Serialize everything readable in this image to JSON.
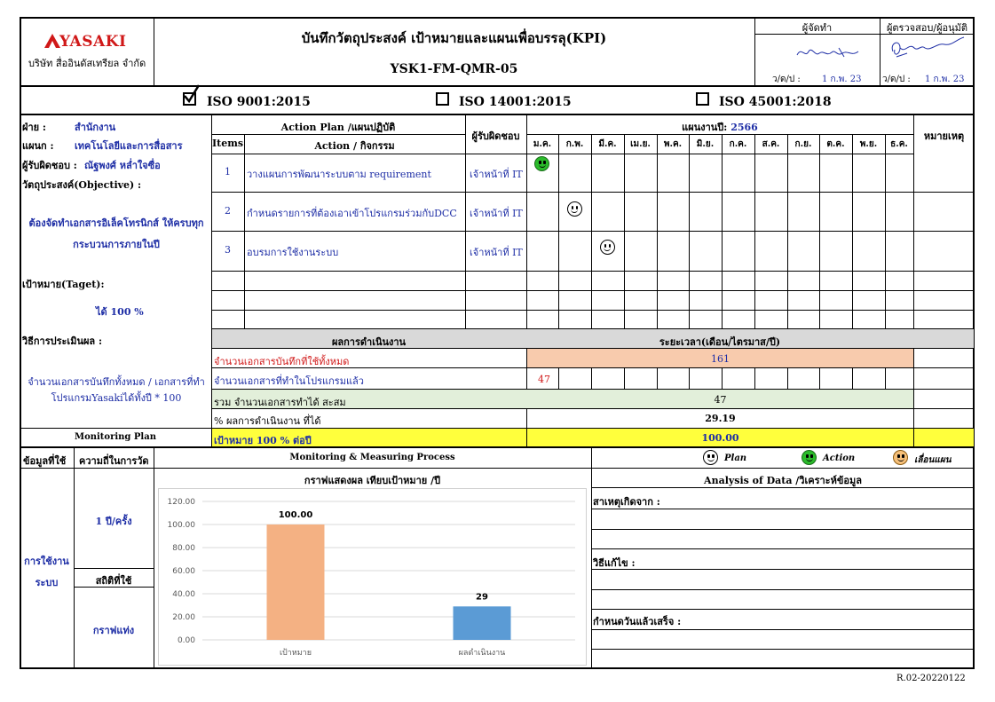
{
  "company": {
    "logo_text": "YASAKI",
    "name_th": "บริษัท สื่ออินดัสเทรียล จำกัด"
  },
  "header": {
    "title": "บันทึกวัตถุประสงค์ เป้าหมายและแผนเพื่อบรรลุ(KPI)",
    "form_code": "YSK1-FM-QMR-05",
    "prepared_by_label": "ผู้จัดทำ",
    "reviewed_by_label": "ผู้ตรวจสอบ/ผู้อนุมัติ",
    "date_label": "ว/ด/ป :",
    "prepared_date": "1 ก.พ. 23",
    "reviewed_date": "1 ก.พ. 23"
  },
  "iso": {
    "items": [
      {
        "label": "ISO 9001:2015",
        "checked": true
      },
      {
        "label": "ISO 14001:2015",
        "checked": false
      },
      {
        "label": "ISO 45001:2018",
        "checked": false
      }
    ]
  },
  "left": {
    "dept_label": "ฝ่าย :",
    "dept_value": "สำนักงาน",
    "section_label": "แผนก :",
    "section_value": "เทคโนโลยีและการสื่อสาร",
    "owner_label": "ผู้รับผิดชอบ :",
    "owner_value": "ณัฐพงศ์ หล่ำใจซื่อ",
    "objective_label": "วัตถุประสงค์(Objective) :",
    "objective_line1": "ต้องจัดทำเอกสารอิเล็คโทรนิกส์ ให้ครบทุก",
    "objective_line2": "กระบวนการภายในปี",
    "target_label": "เป้าหมาย(Taget):",
    "target_value": "ได้ 100 %",
    "eval_label": "วิธีการประเมินผล :",
    "eval_line1": "จำนวนเอกสารบันทึกทั้งหมด / เอกสารที่ทำ",
    "eval_line2": "โปรแกรมYasakiได้ทั้งปี * 100"
  },
  "plan": {
    "action_plan_label": "Action Plan /แผนปฏิบัติ",
    "items_label": "Items",
    "action_label": "Action / กิจกรรม",
    "responsible_label": "ผู้รับผิดชอบ",
    "year_label": "แผนงานปี:",
    "year_value": "2566",
    "remark_label": "หมายเหตุ",
    "months": [
      "ม.ค.",
      "ก.พ.",
      "มี.ค.",
      "เม.ย.",
      "พ.ค.",
      "มิ.ย.",
      "ก.ค.",
      "ส.ค.",
      "ก.ย.",
      "ต.ค.",
      "พ.ย.",
      "ธ.ค."
    ],
    "rows": [
      {
        "no": "1",
        "action": "วางแผนการพัฒนาระบบตาม requirement",
        "owner": "เจ้าหน้าที่ IT",
        "month_index": 0,
        "status": "action"
      },
      {
        "no": "2",
        "action": "กำหนดรายการที่ต้องเอาเข้าโปรแกรมร่วมกับDCC",
        "owner": "เจ้าหน้าที่ IT",
        "month_index": 1,
        "status": "plan"
      },
      {
        "no": "3",
        "action": "อบรมการใช้งานระบบ",
        "owner": "เจ้าหน้าที่ IT",
        "month_index": 2,
        "status": "plan"
      }
    ]
  },
  "results": {
    "result_label": "ผลการดำเนินงาน",
    "period_label": "ระยะเวลา(เดือน/ไตรมาส/ปี)",
    "total_docs_label": "จำนวนเอกสารบันทึกที่ใช้ทั้งหมด",
    "total_docs_value": "161",
    "done_docs_label": "จำนวนเอกสารที่ทำในโปรแกรมแล้ว",
    "done_docs_jan": "47",
    "cumulative_label": "รวม จำนวนเอกสารทำได้ สะสม",
    "cumulative_value": "47",
    "percent_label": "% ผลการดำเนินงาน ที่ได้",
    "percent_value": "29.19",
    "goal_label": "เป้าหมาย 100 % ต่อปี",
    "goal_value": "100.00"
  },
  "monitoring": {
    "plan_label": "Monitoring Plan",
    "data_used_label": "ข้อมูลที่ใช้",
    "frequency_label": "ความถี่ในการวัด",
    "process_label": "Monitoring & Measuring Process",
    "legend_plan": "Plan",
    "legend_action": "Action",
    "legend_postpone": "เลื่อนแผน",
    "data_value_line1": "การใช้งาน",
    "data_value_line2": "ระบบ",
    "frequency_value": "1 ปี/ครั้ง",
    "stat_label": "สถิติที่ใช้",
    "stat_value": "กราฟแท่ง",
    "chart_title": "กราฟแสดงผล เทียบเป้าหมาย /ปี",
    "analysis_label": "Analysis of Data /วิเคราะห์ข้อมูล",
    "cause_label": "สาเหตุเกิดจาก :",
    "fix_label": "วิธีแก้ไข :",
    "due_label": "กำหนดวันแล้วเสร็จ :"
  },
  "footer": {
    "revision": "R.02-20220122"
  },
  "colors": {
    "blue_text": "#1f2fa6",
    "red_text": "#d01818",
    "gray_header": "#d9d9d9",
    "peach": "#f8cbad",
    "light_green": "#e2efda",
    "yellow": "#ffff3c",
    "bar_target": "#f4b183",
    "bar_result": "#5b9bd5"
  },
  "chart_data": {
    "type": "bar",
    "title": "กราฟแสดงผล เทียบเป้าหมาย /ปี",
    "categories": [
      "เป้าหมาย",
      "ผลดำเนินงาน"
    ],
    "values": [
      100,
      29
    ],
    "data_labels": [
      "100.00",
      "29"
    ],
    "yticks": [
      "0.00",
      "20.00",
      "40.00",
      "60.00",
      "80.00",
      "100.00",
      "120.00"
    ],
    "ylim": [
      0,
      120
    ],
    "grid": true,
    "bar_colors": [
      "#f4b183",
      "#5b9bd5"
    ]
  }
}
